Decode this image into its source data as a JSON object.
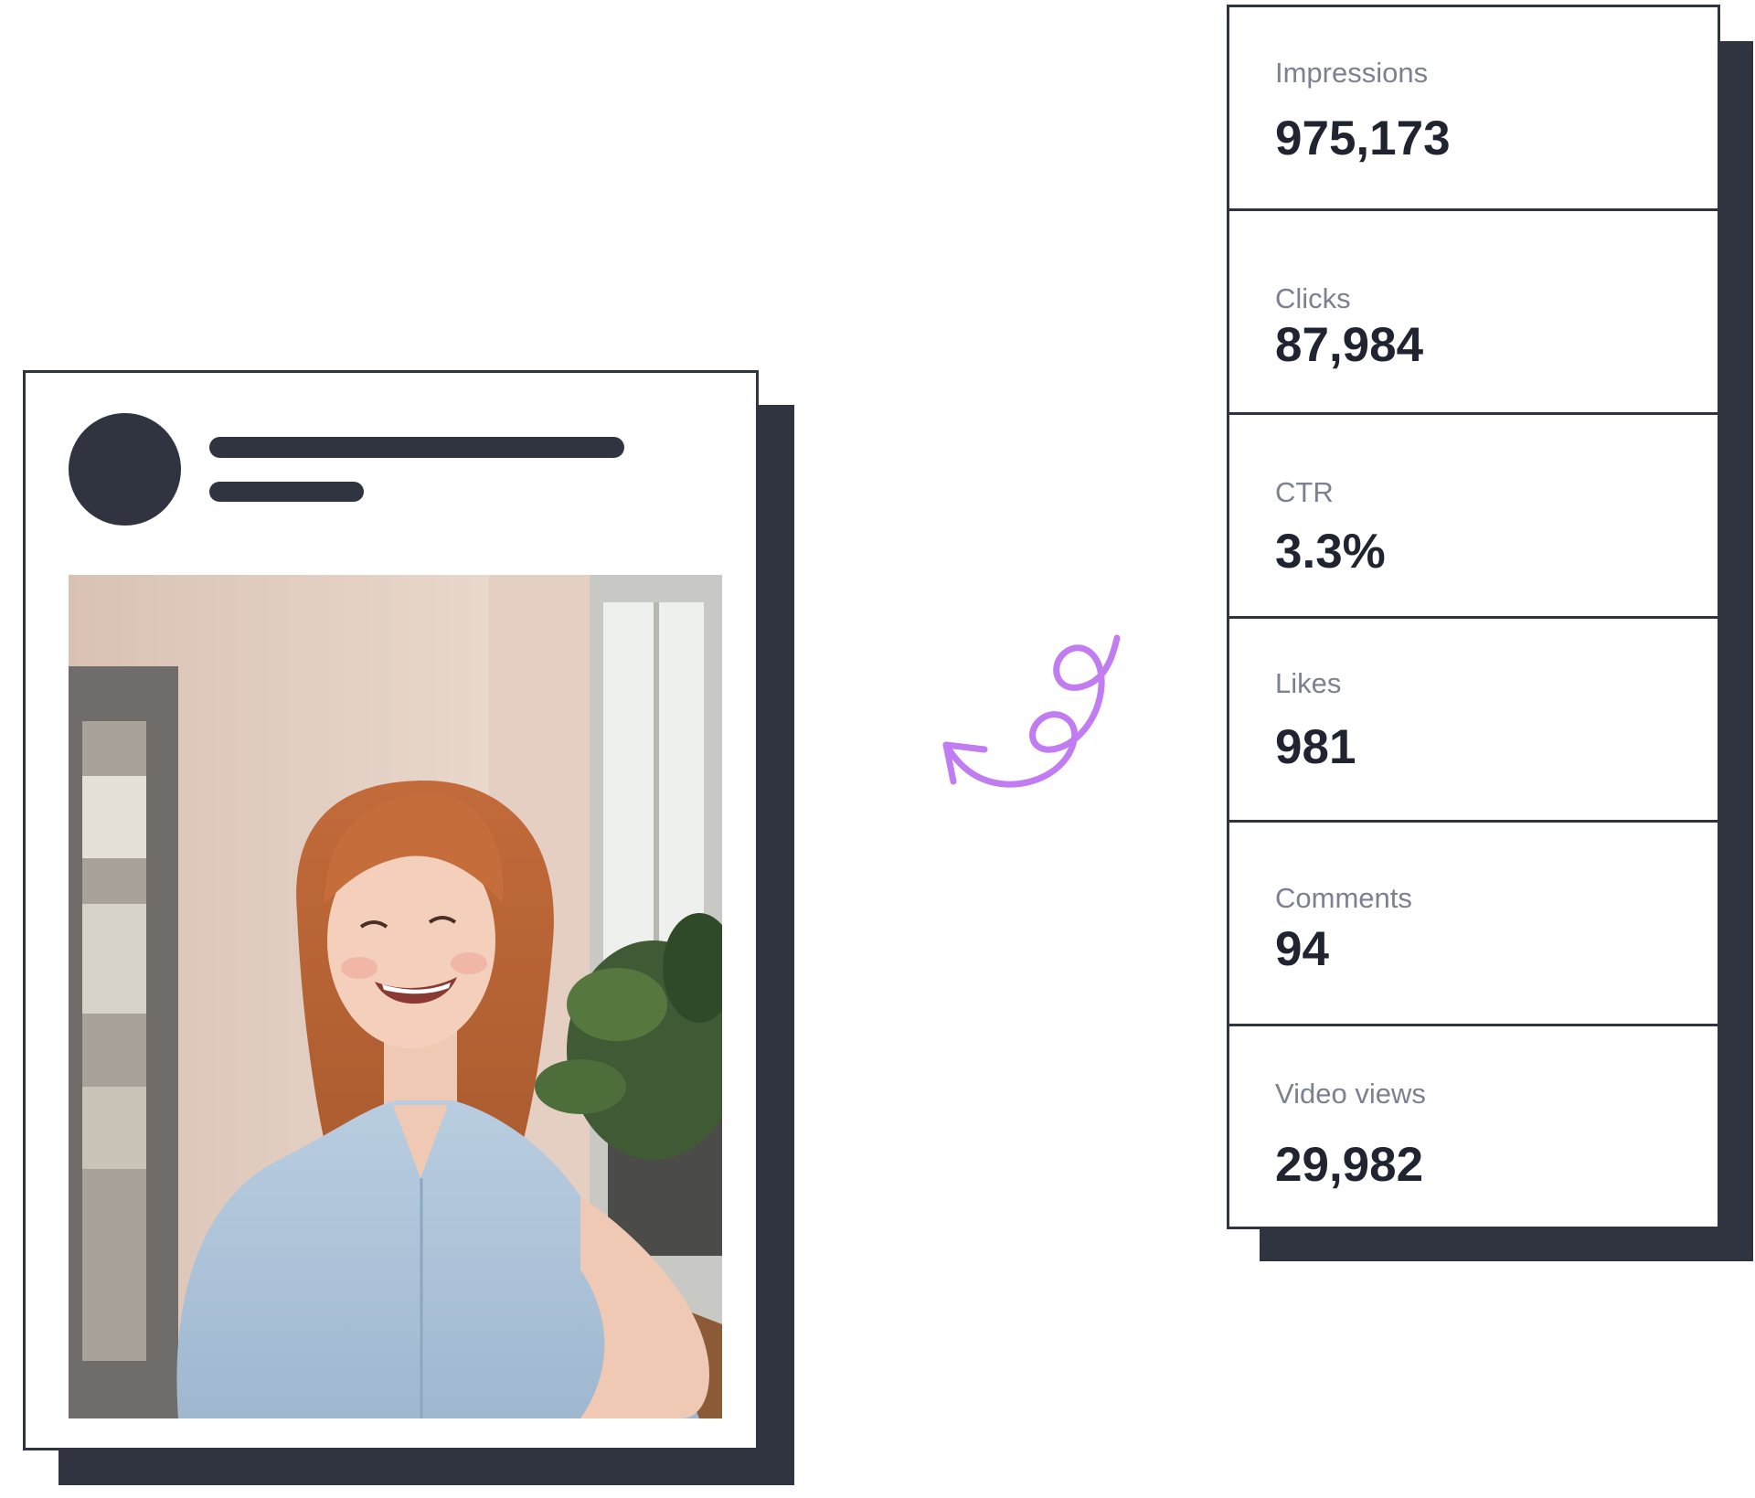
{
  "post": {
    "photo_icon": "photo-of-smiling-woman-in-denim-shirt"
  },
  "arrow_icon": "curly-swirl-arrow-icon",
  "colors": {
    "ink": "#2f3440",
    "accent": "#c07cf0",
    "label": "#7b8190"
  },
  "stats": {
    "impressions": {
      "label": "Impressions",
      "value": "975,173"
    },
    "clicks": {
      "label": "Clicks",
      "value": "87,984"
    },
    "ctr": {
      "label": "CTR",
      "value": "3.3%"
    },
    "likes": {
      "label": "Likes",
      "value": "981"
    },
    "comments": {
      "label": "Comments",
      "value": "94"
    },
    "video_views": {
      "label": "Video views",
      "value": "29,982"
    }
  }
}
